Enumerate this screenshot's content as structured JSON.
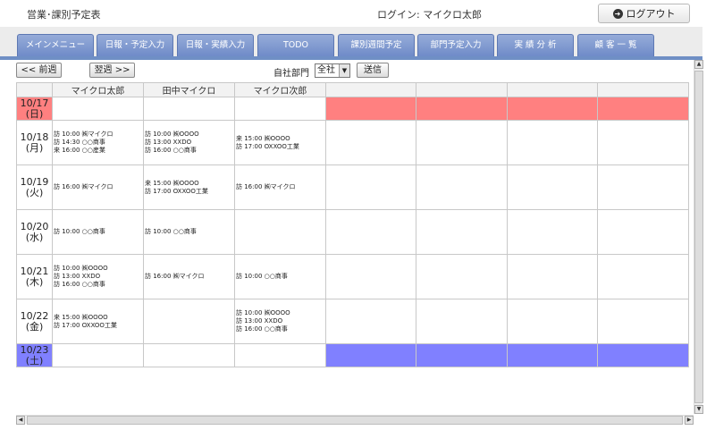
{
  "header": {
    "title": "営業･課別予定表",
    "login_label": "ログイン: マイクロ太郎",
    "logout_label": "ログアウト"
  },
  "tabs": [
    {
      "label": "メインメニュー"
    },
    {
      "label": "日報・予定入力"
    },
    {
      "label": "日報・実績入力"
    },
    {
      "label": "TODO"
    },
    {
      "label": "課別週間予定"
    },
    {
      "label": "部門予定入力"
    },
    {
      "label": "実 績 分 析"
    },
    {
      "label": "顧 客 一 覧"
    }
  ],
  "controls": {
    "prev_week": "<< 前週",
    "next_week": "翌週 >>",
    "dept_label": "自社部門",
    "dept_value": "全社",
    "send": "送信"
  },
  "grid": {
    "columns": [
      "",
      "マイクロ太郎",
      "田中マイクロ",
      "マイクロ次郎",
      "",
      "",
      "",
      ""
    ],
    "rows": [
      {
        "date": "10/17",
        "dow": "(日)",
        "type": "sun",
        "cells": [
          [],
          [],
          []
        ]
      },
      {
        "date": "10/18",
        "dow": "(月)",
        "type": "weekday",
        "cells": [
          [
            "訪 10:00 ㈱マイクロ",
            "訪 14:30 ○○商事",
            "来 16:00 ○○産業"
          ],
          [
            "訪 10:00 ㈱OOOO",
            "訪 13:00 XXDO",
            "訪 16:00 ○○商事"
          ],
          [
            "来 15:00 ㈱OOOO",
            "訪 17:00 OXXOO工業"
          ]
        ]
      },
      {
        "date": "10/19",
        "dow": "(火)",
        "type": "weekday",
        "cells": [
          [
            "訪 16:00 ㈱マイクロ"
          ],
          [
            "来 15:00 ㈱OOOO",
            "訪 17:00 OXXOO工業"
          ],
          [
            "訪 16:00 ㈱マイクロ"
          ]
        ]
      },
      {
        "date": "10/20",
        "dow": "(水)",
        "type": "weekday",
        "cells": [
          [
            "訪 10:00 ○○商事"
          ],
          [
            "訪 10:00 ○○商事"
          ],
          []
        ]
      },
      {
        "date": "10/21",
        "dow": "(木)",
        "type": "weekday",
        "cells": [
          [
            "訪 10:00 ㈱OOOO",
            "訪 13:00 XXDO",
            "訪 16:00 ○○商事"
          ],
          [
            "訪 16:00 ㈱マイクロ"
          ],
          [
            "訪 10:00 ○○商事"
          ]
        ]
      },
      {
        "date": "10/22",
        "dow": "(金)",
        "type": "weekday",
        "cells": [
          [
            "来 15:00 ㈱OOOO",
            "訪 17:00 OXXOO工業"
          ],
          [],
          [
            "訪 10:00 ㈱OOOO",
            "訪 13:00 XXDO",
            "訪 16:00 ○○商事"
          ]
        ]
      },
      {
        "date": "10/23",
        "dow": "(土)",
        "type": "sat",
        "cells": [
          [],
          [],
          []
        ]
      }
    ]
  },
  "colors": {
    "sunday_row": "#ff8080",
    "saturday_row": "#8080ff",
    "tab_bg": "#7c96cf"
  },
  "icons": {
    "logout": "logout-arrow-icon"
  }
}
